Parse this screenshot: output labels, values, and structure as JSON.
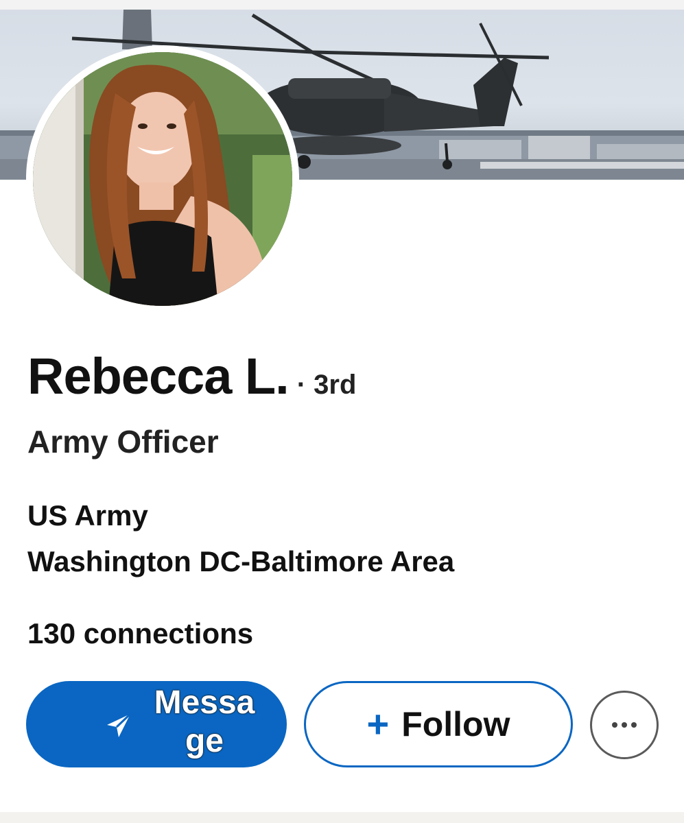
{
  "profile": {
    "name": "Rebecca L.",
    "degree": "· 3rd",
    "headline": "Army Officer",
    "company": "US Army",
    "location": "Washington DC-Baltimore Area",
    "connections": "130 connections"
  },
  "actions": {
    "message_label": "Message",
    "follow_plus": "+",
    "follow_label": "Follow",
    "more_icon": "more-horizontal-icon"
  },
  "images": {
    "banner": "banner-helicopter-image",
    "avatar": "profile-photo"
  },
  "colors": {
    "accent": "#0a66c2",
    "text": "#111111",
    "background": "#ffffff"
  }
}
